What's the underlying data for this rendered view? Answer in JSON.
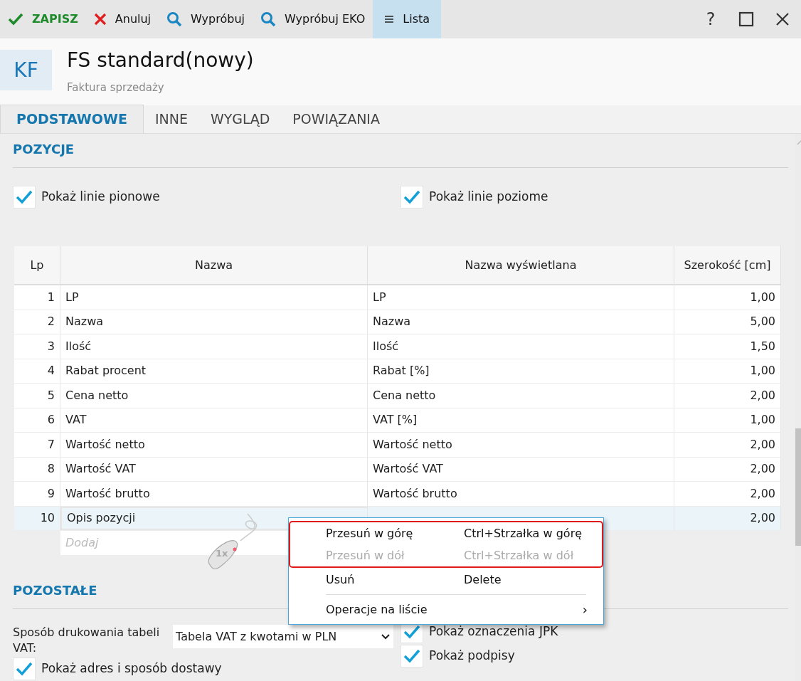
{
  "toolbar": [
    {
      "kind": "save",
      "label": "ZAPISZ",
      "selected": false
    },
    {
      "kind": "cancel",
      "label": "Anuluj",
      "selected": false
    },
    {
      "kind": "search",
      "label": "Wypróbuj",
      "selected": false
    },
    {
      "kind": "search",
      "label": "Wypróbuj EKO",
      "selected": false
    },
    {
      "kind": "list",
      "label": "Lista",
      "selected": true
    }
  ],
  "window_buttons": [
    "?"
  ],
  "header": {
    "badge": "KF",
    "title": "FS standard(nowy)",
    "subtitle": "Faktura sprzedaży"
  },
  "tabs": [
    {
      "label": "PODSTAWOWE",
      "selected": true
    },
    {
      "label": "INNE",
      "selected": false
    },
    {
      "label": "WYGLĄD",
      "selected": false
    },
    {
      "label": "POWIĄZANIA",
      "selected": false
    }
  ],
  "pozycje": {
    "title": "POZYCJE",
    "options": [
      {
        "label": "Pokaż linie pionowe",
        "checked": true
      },
      {
        "label": "Pokaż linie poziome",
        "checked": true
      }
    ],
    "table": {
      "columns": [
        "Lp",
        "Nazwa",
        "Nazwa wyświetlana",
        "Szerokość [cm]"
      ],
      "rows": [
        {
          "cells": [
            "1",
            "LP",
            "LP",
            "1,00"
          ],
          "selected": false
        },
        {
          "cells": [
            "2",
            "Nazwa",
            "Nazwa",
            "5,00"
          ],
          "selected": false
        },
        {
          "cells": [
            "3",
            "Ilość",
            "Ilość",
            "1,50"
          ],
          "selected": false
        },
        {
          "cells": [
            "4",
            "Rabat procent",
            "Rabat [%]",
            "1,00"
          ],
          "selected": false
        },
        {
          "cells": [
            "5",
            "Cena netto",
            "Cena netto",
            "2,00"
          ],
          "selected": false
        },
        {
          "cells": [
            "6",
            "VAT",
            "VAT [%]",
            "1,00"
          ],
          "selected": false
        },
        {
          "cells": [
            "7",
            "Wartość netto",
            "Wartość netto",
            "2,00"
          ],
          "selected": false
        },
        {
          "cells": [
            "8",
            "Wartość VAT",
            "Wartość VAT",
            "2,00"
          ],
          "selected": false
        },
        {
          "cells": [
            "9",
            "Wartość brutto",
            "Wartość brutto",
            "2,00"
          ],
          "selected": false
        },
        {
          "cells": [
            "10",
            "Opis pozycji",
            null,
            "2,00"
          ],
          "selected": true
        }
      ],
      "add_placeholder": "Dodaj"
    }
  },
  "pozostale": {
    "title": "POZOSTAŁE",
    "vat_label": "Sposób drukowania tabeli VAT:",
    "vat_value": "Tabela VAT z kwotami w PLN",
    "left_options": [
      {
        "label": "Pokaż adres i sposób dostawy",
        "checked": true
      }
    ],
    "right_options": [
      {
        "label": "Pokaż oznaczenia JPK",
        "checked": true
      },
      {
        "label": "Pokaż podpisy",
        "checked": true
      }
    ]
  },
  "click_badge": "1x",
  "context_menu": [
    {
      "label": "Przesuń w górę",
      "shortcut": "Ctrl+Strzałka w górę",
      "disabled": false,
      "highlighted": true
    },
    {
      "label": "Przesuń w dół",
      "shortcut": "Ctrl+Strzałka w dół",
      "disabled": true,
      "highlighted": true
    },
    {
      "label": "Usuń",
      "shortcut": "Delete",
      "disabled": false,
      "highlighted": false
    },
    {
      "label": "Operacje na liście",
      "submenu": "›",
      "disabled": false,
      "highlighted": false
    }
  ]
}
